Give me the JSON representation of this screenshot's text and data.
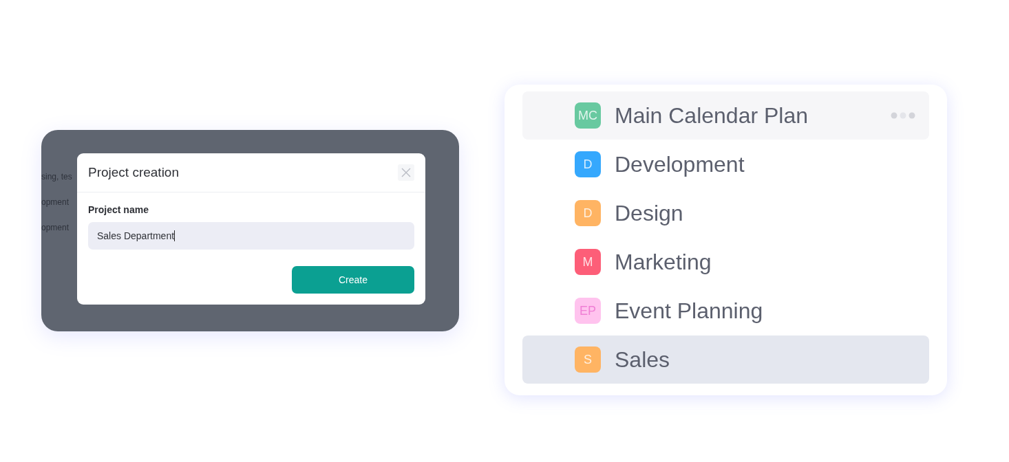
{
  "background_texts": [
    "sing, tes",
    "opment",
    "opment"
  ],
  "dialog": {
    "title": "Project creation",
    "field_label": "Project name",
    "field_value": "Sales Department",
    "button": "Create"
  },
  "projects": [
    {
      "initials": "MC",
      "name": "Main Calendar Plan",
      "color": "#68c9a0",
      "hovered": true,
      "selected": false
    },
    {
      "initials": "D",
      "name": "Development",
      "color": "#35a8fd",
      "hovered": false,
      "selected": false
    },
    {
      "initials": "D",
      "name": "Design",
      "color": "#ffb463",
      "hovered": false,
      "selected": false
    },
    {
      "initials": "M",
      "name": "Marketing",
      "color": "#fd5e78",
      "hovered": false,
      "selected": false
    },
    {
      "initials": "EP",
      "name": "Event Planning",
      "color": "#ffc3ee",
      "hovered": false,
      "selected": false
    },
    {
      "initials": "S",
      "name": "Sales",
      "color": "#ffb463",
      "hovered": false,
      "selected": true
    }
  ]
}
